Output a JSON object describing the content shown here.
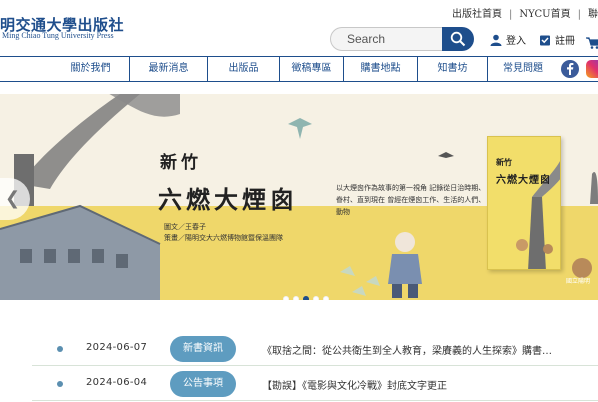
{
  "brand": {
    "name_cn": "明交通大學出版社",
    "name_en": "Ming Chiao Tung University Press"
  },
  "toplinks": [
    "出版社首頁",
    "NYCU首頁",
    "聯"
  ],
  "search": {
    "placeholder": "Search"
  },
  "account": {
    "login": "登入",
    "register": "註冊"
  },
  "nav": {
    "items": [
      "關於我們",
      "最新消息",
      "出版品",
      "徵稿專區",
      "購書地點",
      "知書坊",
      "常見問題"
    ]
  },
  "banner": {
    "title_small": "新竹",
    "title": "六燃大煙囪",
    "desc": "以大煙囪作為故事的第一視角 記錄從日治時期、眷村、直到現在 曾經在煙囪工作、生活的人們、動物",
    "credit_line1": "圖文／王春子",
    "credit_line2": "策畫／陽明交大六燃博物館暨保溫團隊",
    "book_title_small": "新竹",
    "book_title": "六燃大煙囪",
    "book_caption": "國立陽明",
    "dots_total": 5,
    "dots_active_index": 2
  },
  "news": [
    {
      "date": "2024-06-07",
      "category": "新書資訊",
      "title": "《取捨之間：從公共衛生到全人教育，梁賡義的人生探索》購書…"
    },
    {
      "date": "2024-06-04",
      "category": "公告事項",
      "title": "【勘誤】《電影與文化冷戰》封底文字更正"
    }
  ],
  "colors": {
    "brand_blue": "#1e4e8c",
    "badge_blue": "#5e9cc0",
    "banner_yellow": "#efd76a"
  },
  "icons": [
    "search-icon",
    "user-icon",
    "register-icon",
    "cart-icon",
    "facebook-icon",
    "instagram-icon",
    "chevron-left-icon"
  ]
}
